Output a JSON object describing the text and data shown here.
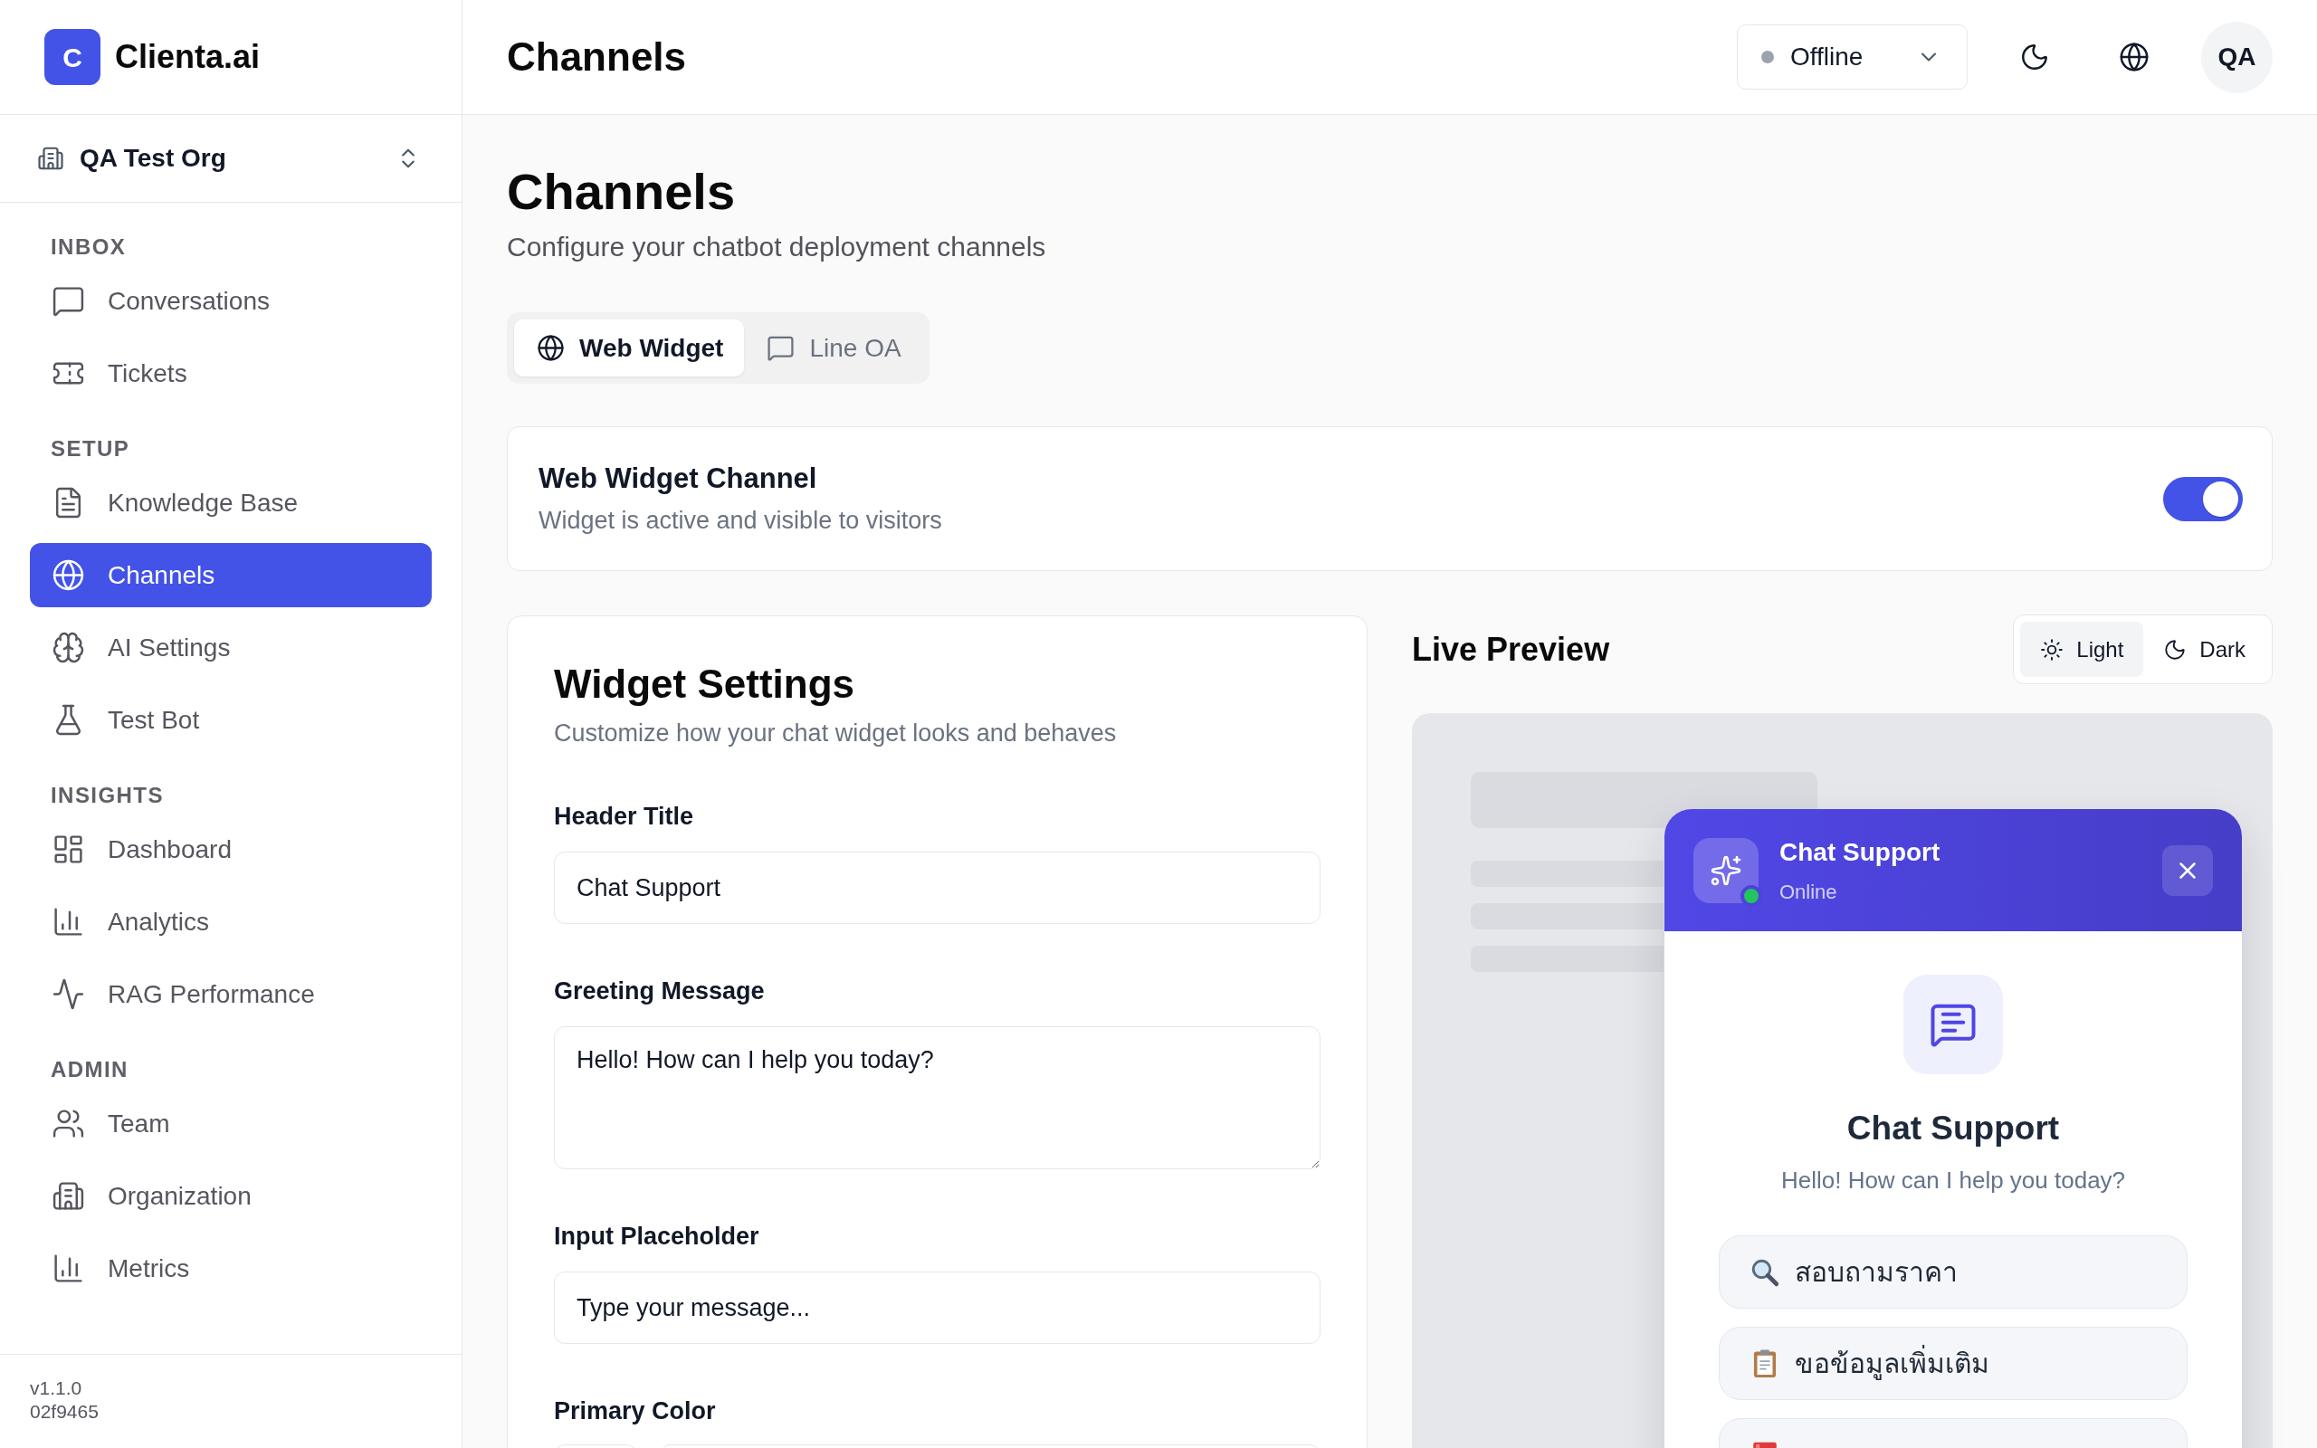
{
  "sidebar": {
    "brand": {
      "logo_letter": "C",
      "name": "Clienta.ai"
    },
    "org_switcher": {
      "name": "QA Test Org"
    },
    "sections": [
      {
        "title": "INBOX",
        "items": [
          {
            "label": "Conversations",
            "selected": false
          },
          {
            "label": "Tickets",
            "selected": false
          }
        ]
      },
      {
        "title": "SETUP",
        "items": [
          {
            "label": "Knowledge Base",
            "selected": false
          },
          {
            "label": "Channels",
            "selected": true
          },
          {
            "label": "AI Settings",
            "selected": false
          },
          {
            "label": "Test Bot",
            "selected": false
          }
        ]
      },
      {
        "title": "INSIGHTS",
        "items": [
          {
            "label": "Dashboard",
            "selected": false
          },
          {
            "label": "Analytics",
            "selected": false
          },
          {
            "label": "RAG Performance",
            "selected": false
          }
        ]
      },
      {
        "title": "ADMIN",
        "items": [
          {
            "label": "Team",
            "selected": false
          },
          {
            "label": "Organization",
            "selected": false
          },
          {
            "label": "Metrics",
            "selected": false
          }
        ]
      }
    ],
    "footer": {
      "version": "v1.1.0",
      "build": "02f9465"
    }
  },
  "header": {
    "title": "Channels",
    "status": {
      "label": "Offline",
      "online": false
    },
    "avatar": {
      "initials": "QA"
    }
  },
  "page": {
    "title": "Channels",
    "subtitle": "Configure your chatbot deployment channels"
  },
  "tabs": [
    {
      "label": "Web Widget",
      "selected": true
    },
    {
      "label": "Line OA",
      "selected": false
    }
  ],
  "channel_card": {
    "title": "Web Widget Channel",
    "description": "Widget is active and visible to visitors",
    "on": true
  },
  "widget_settings": {
    "title": "Widget Settings",
    "subtitle": "Customize how your chat widget looks and behaves",
    "fields": [
      {
        "kind": "input",
        "label": "Header Title",
        "value": "Chat Support"
      },
      {
        "kind": "textarea",
        "label": "Greeting Message",
        "value": "Hello! How can I help you today?"
      },
      {
        "kind": "input",
        "label": "Input Placeholder",
        "value": "Type your message..."
      },
      {
        "kind": "color",
        "label": "Primary Color"
      }
    ]
  },
  "live_preview": {
    "title": "Live Preview",
    "theme_options": [
      {
        "label": "Light",
        "selected": true
      },
      {
        "label": "Dark",
        "selected": false
      }
    ],
    "widget": {
      "title": "Chat Support",
      "status": "Online",
      "online": true,
      "welcome_title": "Chat Support",
      "welcome_message": "Hello! How can I help you today?",
      "quick_replies": [
        {
          "kind": "reply",
          "label": "สอบถามราคา"
        },
        {
          "kind": "reply",
          "label": "ขอข้อมูลเพิ่มเติม"
        },
        {
          "kind": "partial"
        }
      ]
    }
  }
}
